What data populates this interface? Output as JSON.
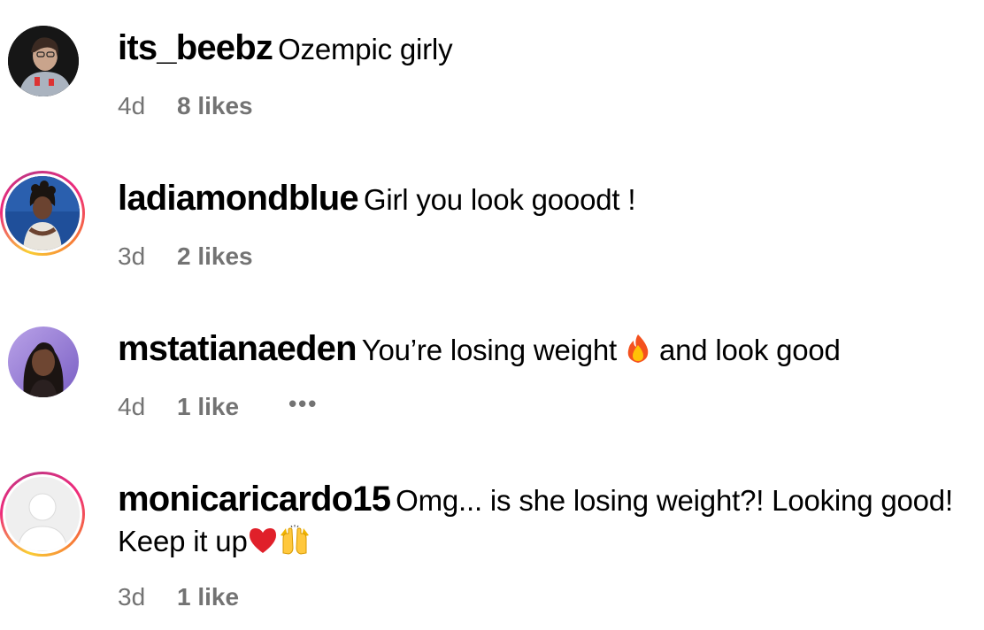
{
  "comments": [
    {
      "username": "its_beebz",
      "text": "Ozempic girly",
      "time": "4d",
      "likes": "8 likes"
    },
    {
      "username": "ladiamondblue",
      "text": "Girl you look gooodt !",
      "time": "3d",
      "likes": "2 likes"
    },
    {
      "username": "mstatianaeden",
      "text_before": "You’re losing weight",
      "text_after": "and look good",
      "emoji": "fire-emoji",
      "time": "4d",
      "likes": "1 like",
      "more": "•••"
    },
    {
      "username": "monicaricardo15",
      "text": "Omg... is she losing weight?! Looking good! Keep it up",
      "emojis": [
        "red-heart-emoji",
        "raising-hands-emoji"
      ],
      "time": "3d",
      "likes": "1 like"
    }
  ],
  "colors": {
    "meta_text": "#737373",
    "story_ring_start": "#f9ce34",
    "story_ring_mid": "#ee2a7b",
    "story_ring_end": "#c13584"
  }
}
